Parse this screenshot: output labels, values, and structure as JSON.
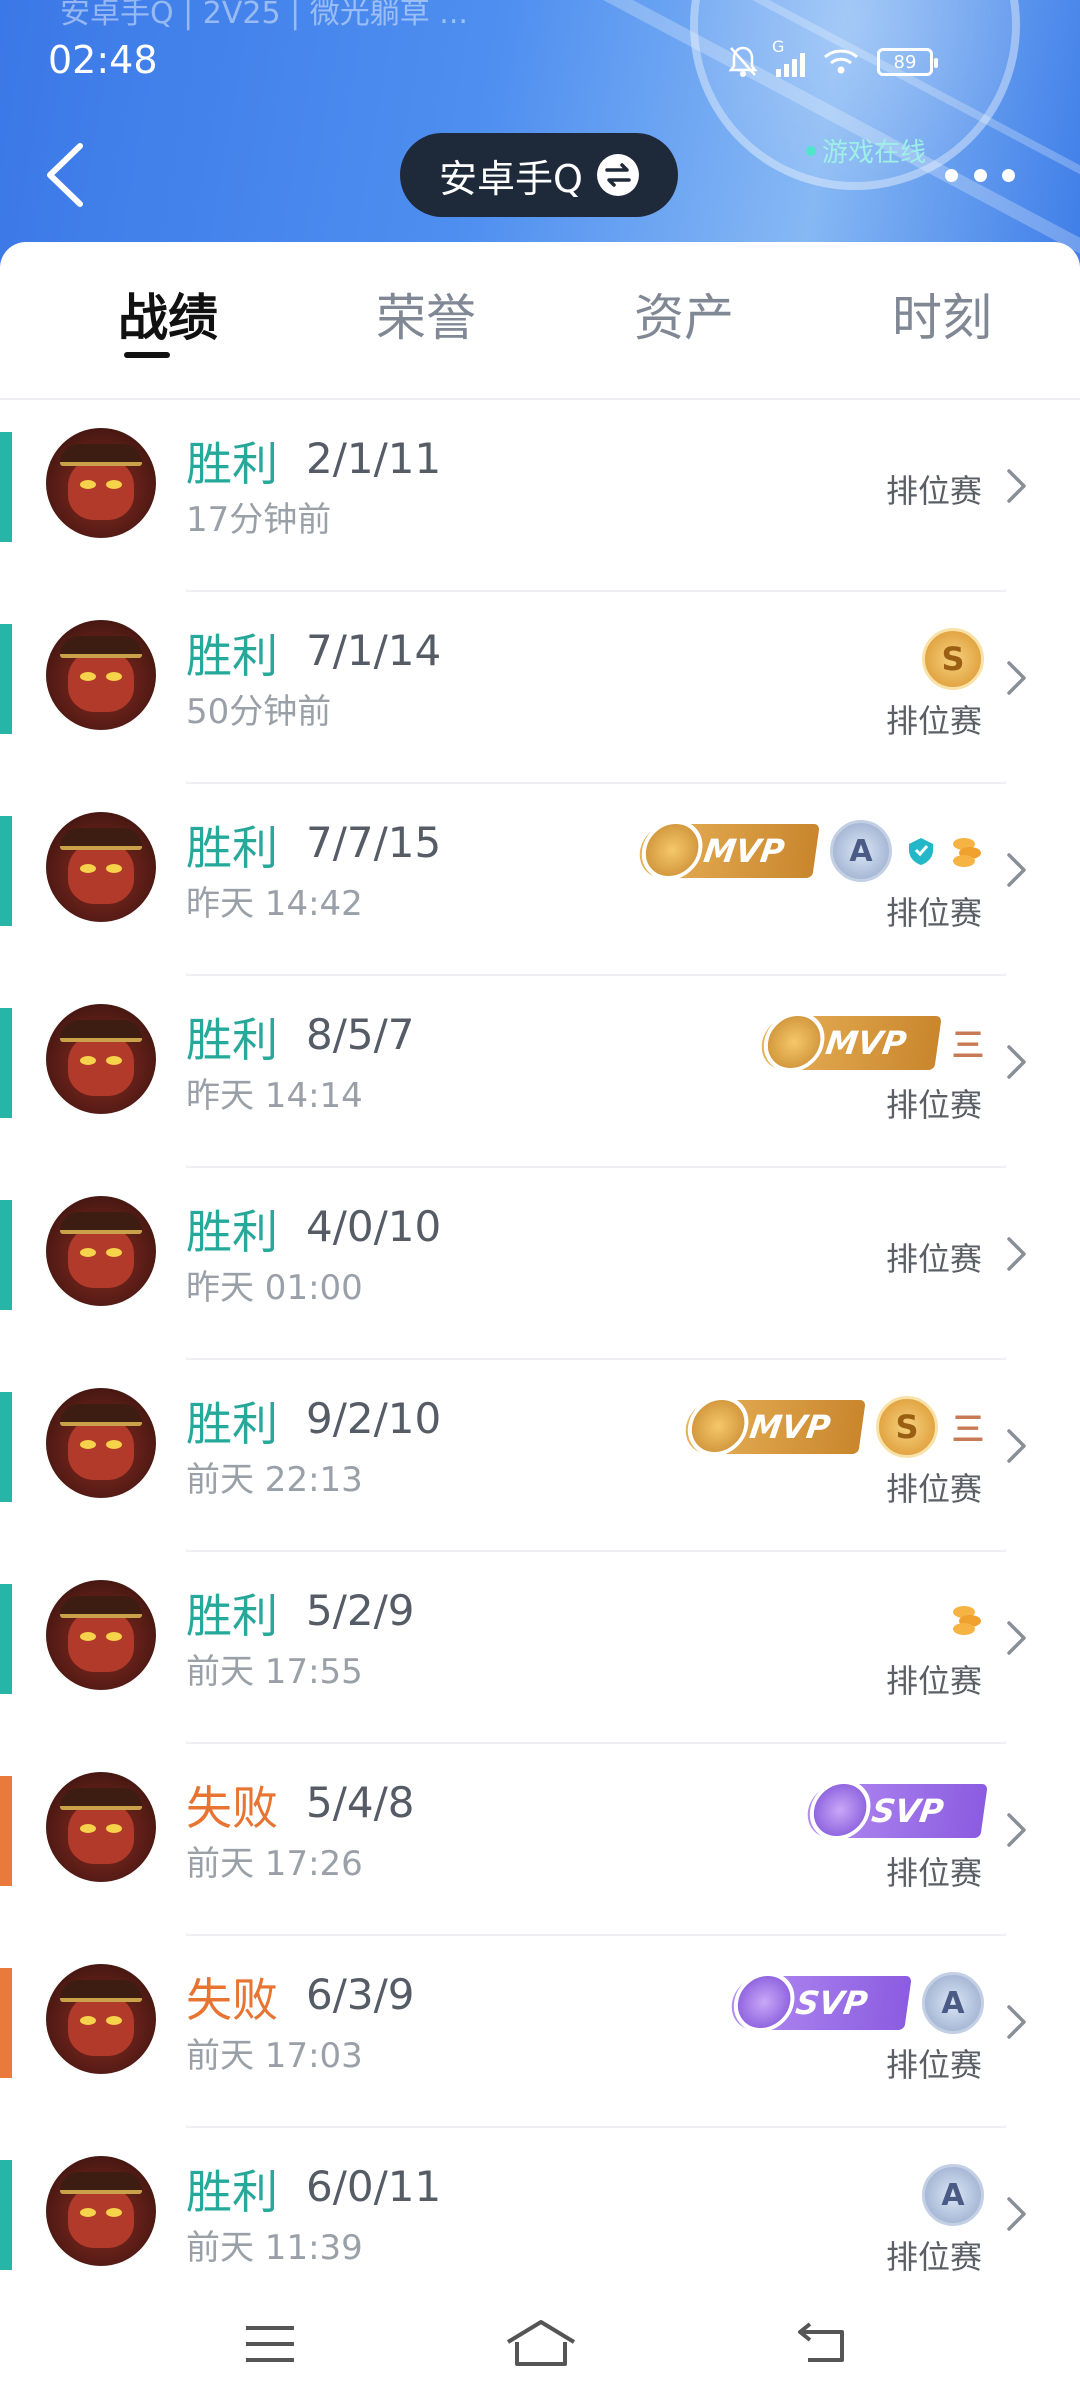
{
  "status_bar": {
    "top_text": "安卓手Q | 2V25 | 微光躺草 ...",
    "time": "02:48",
    "signal_label": "G",
    "battery": "89"
  },
  "header": {
    "title": "安卓手Q",
    "online_status": "游戏在线"
  },
  "tabs": [
    {
      "label": "战绩",
      "active": true
    },
    {
      "label": "荣誉",
      "active": false
    },
    {
      "label": "资产",
      "active": false
    },
    {
      "label": "时刻",
      "active": false
    }
  ],
  "records": [
    {
      "result": "胜利",
      "kda": "2/1/11",
      "time": "17分钟前",
      "mode": "排位赛",
      "badges": []
    },
    {
      "result": "胜利",
      "kda": "7/1/14",
      "time": "50分钟前",
      "mode": "排位赛",
      "badges": [
        "S"
      ]
    },
    {
      "result": "胜利",
      "kda": "7/7/15",
      "time": "昨天 14:42",
      "mode": "排位赛",
      "badges": [
        "MVP",
        "A",
        "shield",
        "coins"
      ]
    },
    {
      "result": "胜利",
      "kda": "8/5/7",
      "time": "昨天 14:14",
      "mode": "排位赛",
      "badges": [
        "MVP",
        "三"
      ]
    },
    {
      "result": "胜利",
      "kda": "4/0/10",
      "time": "昨天 01:00",
      "mode": "排位赛",
      "badges": []
    },
    {
      "result": "胜利",
      "kda": "9/2/10",
      "time": "前天 22:13",
      "mode": "排位赛",
      "badges": [
        "MVP",
        "S",
        "三"
      ]
    },
    {
      "result": "胜利",
      "kda": "5/2/9",
      "time": "前天 17:55",
      "mode": "排位赛",
      "badges": [
        "coins"
      ]
    },
    {
      "result": "失败",
      "kda": "5/4/8",
      "time": "前天 17:26",
      "mode": "排位赛",
      "badges": [
        "SVP"
      ]
    },
    {
      "result": "失败",
      "kda": "6/3/9",
      "time": "前天 17:03",
      "mode": "排位赛",
      "badges": [
        "SVP",
        "A"
      ]
    },
    {
      "result": "胜利",
      "kda": "6/0/11",
      "time": "前天 11:39",
      "mode": "排位赛",
      "badges": [
        "A"
      ]
    }
  ],
  "badge_labels": {
    "mvp": "MVP",
    "svp": "SVP",
    "s": "S",
    "a": "A",
    "three": "三"
  },
  "colors": {
    "win": "#26b5a6",
    "loss": "#ea7a3c",
    "header_blue": "#3b78e7"
  },
  "icons": {
    "back": "chevron-left-icon",
    "swap": "swap-icon",
    "more": "more-dots-icon",
    "row_arrow": "chevron-right-icon",
    "nav": [
      "menu-icon",
      "home-icon",
      "back-icon"
    ]
  }
}
